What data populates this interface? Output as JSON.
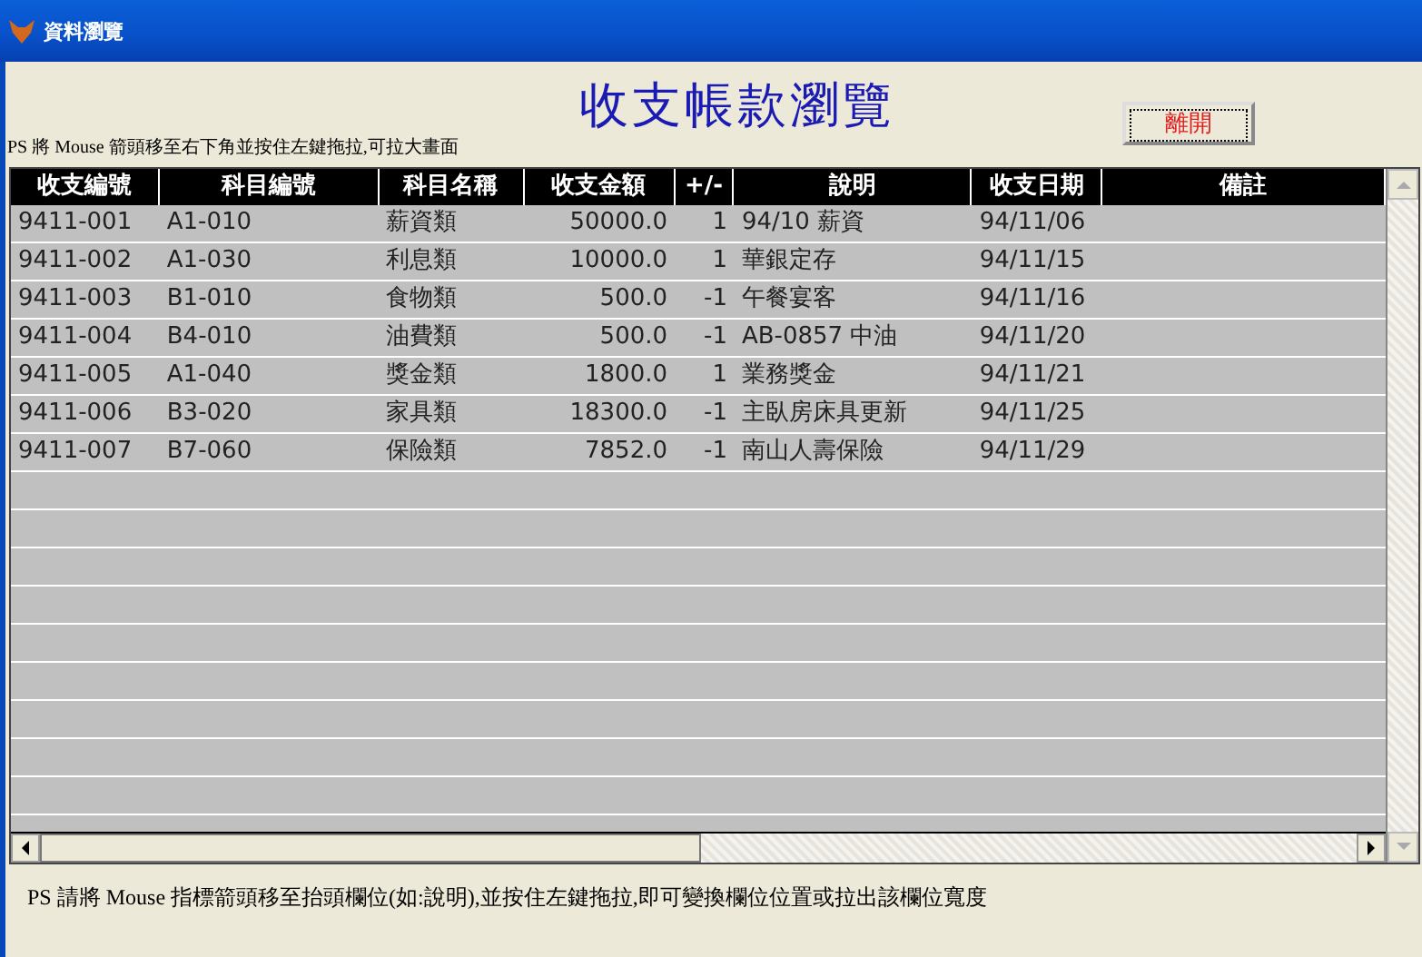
{
  "window": {
    "title": "資料瀏覽"
  },
  "heading": "收支帳款瀏覽",
  "top_hint": "PS 將 Mouse 箭頭移至右下角並按住左鍵拖拉,可拉大畫面",
  "close_button": "離開",
  "table": {
    "columns": [
      "收支編號",
      "科目編號",
      "科目名稱",
      "收支金額",
      "+/-",
      "說明",
      "收支日期",
      "備註"
    ],
    "rows": [
      [
        "9411-001",
        "A1-010",
        "薪資類",
        "50000.0",
        "1",
        "94/10 薪資",
        "94/11/06"
      ],
      [
        "9411-002",
        "A1-030",
        "利息類",
        "10000.0",
        "1",
        "華銀定存",
        "94/11/15"
      ],
      [
        "9411-003",
        "B1-010",
        "食物類",
        "500.0",
        "-1",
        "午餐宴客",
        "94/11/16"
      ],
      [
        "9411-004",
        "B4-010",
        "油費類",
        "500.0",
        "-1",
        "AB-0857 中油",
        "94/11/20"
      ],
      [
        "9411-005",
        "A1-040",
        "獎金類",
        "1800.0",
        "1",
        "業務獎金",
        "94/11/21"
      ],
      [
        "9411-006",
        "B3-020",
        "家具類",
        "18300.0",
        "-1",
        "主臥房床具更新",
        "94/11/25"
      ],
      [
        "9411-007",
        "B7-060",
        "保險類",
        "7852.0",
        "-1",
        "南山人壽保險",
        "94/11/29"
      ]
    ]
  },
  "bottom_hint": "PS  請將 Mouse 指標箭頭移至抬頭欄位(如:說明),並按住左鍵拖拉,即可變換欄位位置或拉出該欄位寬度"
}
